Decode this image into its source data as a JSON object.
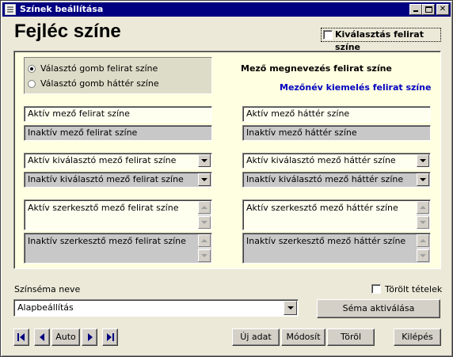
{
  "window": {
    "title": "Színek beállítása"
  },
  "header": {
    "title": "Fejléc színe",
    "select_label_checkbox": "Kiválasztás felirat színe",
    "select_label_checked": false
  },
  "radio_group": {
    "options": [
      {
        "label": "Választó gomb felirat színe",
        "selected": true
      },
      {
        "label": "Választó gomb háttér színe",
        "selected": false
      }
    ]
  },
  "labels": {
    "field_name_text_color": "Mező megnevezés felirat színe",
    "field_name_highlight_color": "Mezőnév kiemelés felirat színe"
  },
  "fields": {
    "active_text": "Aktív mező felirat színe",
    "inactive_text": "Inaktív mező felirat színe",
    "active_bg": "Aktív mező háttér színe",
    "inactive_bg": "Inaktív mező háttér színe"
  },
  "combos": {
    "active_select_text": "Aktív kiválasztó mező felirat színe",
    "inactive_select_text": "Inaktív kiválasztó mező felirat színe",
    "active_select_bg": "Aktív kiválasztó mező háttér színe",
    "inactive_select_bg": "Inaktív kiválasztó mező háttér színe"
  },
  "memos": {
    "active_edit_text": "Aktív szerkesztő mező felirat színe",
    "inactive_edit_text": "Inaktív szerkesztő mező felirat színe",
    "active_edit_bg": "Aktív szerkesztő mező háttér színe",
    "inactive_edit_bg": "Inaktív szerkesztő mező háttér színe"
  },
  "scheme": {
    "label": "Színséma neve",
    "value": "Alapbeállítás",
    "deleted_items_label": "Törölt tételek",
    "deleted_items_checked": false,
    "activate_button": "Séma aktiválása"
  },
  "navigation": {
    "auto_label": "Auto"
  },
  "actions": {
    "new": "Új adat",
    "modify": "Módosít",
    "delete": "Töröl",
    "exit": "Kilépés"
  },
  "colors": {
    "title_bar": "#000080",
    "panel_bg": "#ffffe1",
    "inactive_field": "#c8c8c8",
    "highlight_text": "#0000c0"
  }
}
